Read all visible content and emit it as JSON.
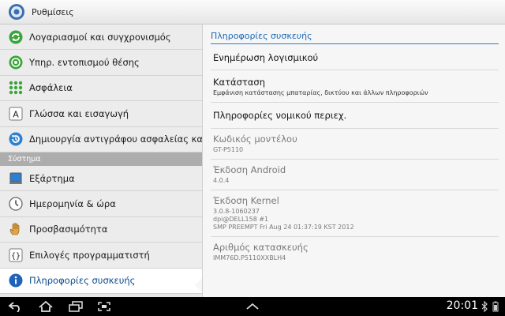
{
  "app": {
    "title": "Ρυθμίσεις"
  },
  "sidebar": {
    "items": [
      {
        "label": "Λογαριασμοί και συγχρονισμός",
        "icon": "sync-icon"
      },
      {
        "label": "Υπηρ. εντοπισμού θέσης",
        "icon": "location-icon"
      },
      {
        "label": "Ασφάλεια",
        "icon": "security-grid-icon"
      },
      {
        "label": "Γλώσσα και εισαγωγή",
        "icon": "language-a-icon"
      },
      {
        "label": "Δημιουργία αντιγράφου ασφαλείας και επαναφορά",
        "icon": "backup-icon"
      }
    ],
    "section_header": "Σύστημα",
    "system_items": [
      {
        "label": "Εξάρτημα",
        "icon": "dock-icon"
      },
      {
        "label": "Ημερομηνία & ώρα",
        "icon": "clock-icon"
      },
      {
        "label": "Προσβασιμότητα",
        "icon": "hand-icon"
      },
      {
        "label": "Επιλογές προγραμματιστή",
        "icon": "braces-icon"
      },
      {
        "label": "Πληροφορίες συσκευής",
        "icon": "info-icon",
        "selected": true
      }
    ]
  },
  "detail": {
    "header": "Πληροφορίες συσκευής",
    "rows": [
      {
        "title": "Ενημέρωση λογισμικού"
      },
      {
        "title": "Κατάσταση",
        "subtitle": "Εμφάνιση κατάστασης μπαταρίας, δικτύου και άλλων πληροφοριών"
      },
      {
        "title": "Πληροφορίες νομικού περιεχ."
      },
      {
        "title": "Κωδικός μοντέλου",
        "subtitle": "GT-P5110"
      },
      {
        "title": "Έκδοση Android",
        "subtitle": "4.0.4"
      },
      {
        "title": "Έκδοση Kernel",
        "line1": "3.0.8-1060237",
        "line2": "dpi@DELL158 #1",
        "line3": "SMP PREEMPT Fri Aug 24 01:37:19 KST 2012"
      },
      {
        "title": "Αριθμός κατασκευής",
        "subtitle": "IMM76D.P5110XXBLH4"
      }
    ]
  },
  "statusbar": {
    "time": "20:01"
  },
  "colors": {
    "accent": "#1b67b4",
    "selected_text": "#0c4b8e"
  }
}
